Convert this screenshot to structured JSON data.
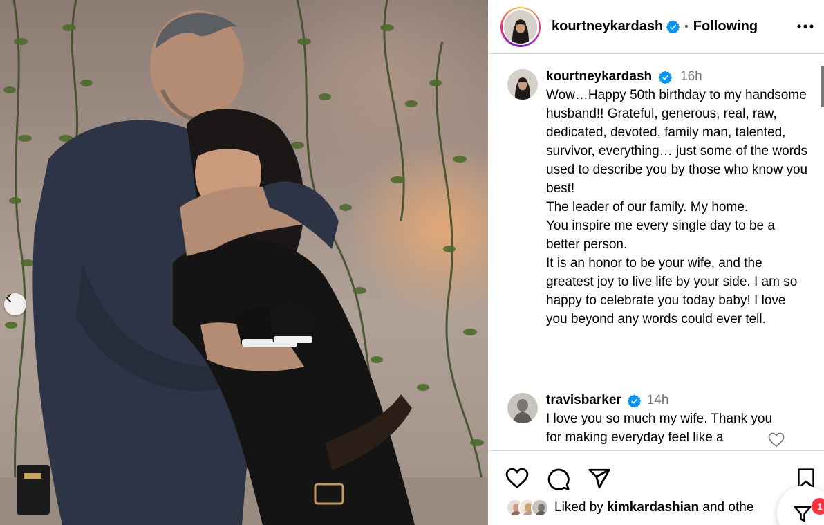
{
  "post": {
    "author": "kourtneykardash",
    "follow_status": "Following",
    "separator": "•"
  },
  "caption": {
    "username": "kourtneykardash",
    "time": "16h",
    "text": "Wow…Happy 50th birthday to my handsome husband!! Grateful, generous, real, raw, dedicated, devoted, family man, talented, survivor, everything… just some of the words used to describe you by those who know you best!\nThe leader of our family. My home.\nYou inspire me every single day to be a better person.\nIt is an honor to be your wife, and the greatest joy to live life by your side. I am so happy to celebrate you today baby! I love you beyond any words could ever tell."
  },
  "comment": {
    "username": "travisbarker",
    "time": "14h",
    "text": "I love you so much my wife. Thank you for making everyday feel like a"
  },
  "likes": {
    "prefix": "Liked by ",
    "user": "kimkardashian",
    "suffix": " and othe"
  },
  "notifications": {
    "count": "1"
  },
  "colors": {
    "verified": "#0095f6",
    "badge": "#ff3040",
    "divider": "#dbdbdb",
    "muted": "#737373"
  },
  "icons": [
    "more-icon",
    "verified-icon",
    "heart-icon",
    "comment-icon",
    "share-icon",
    "bookmark-icon",
    "chevron-left-icon",
    "filter-icon"
  ]
}
